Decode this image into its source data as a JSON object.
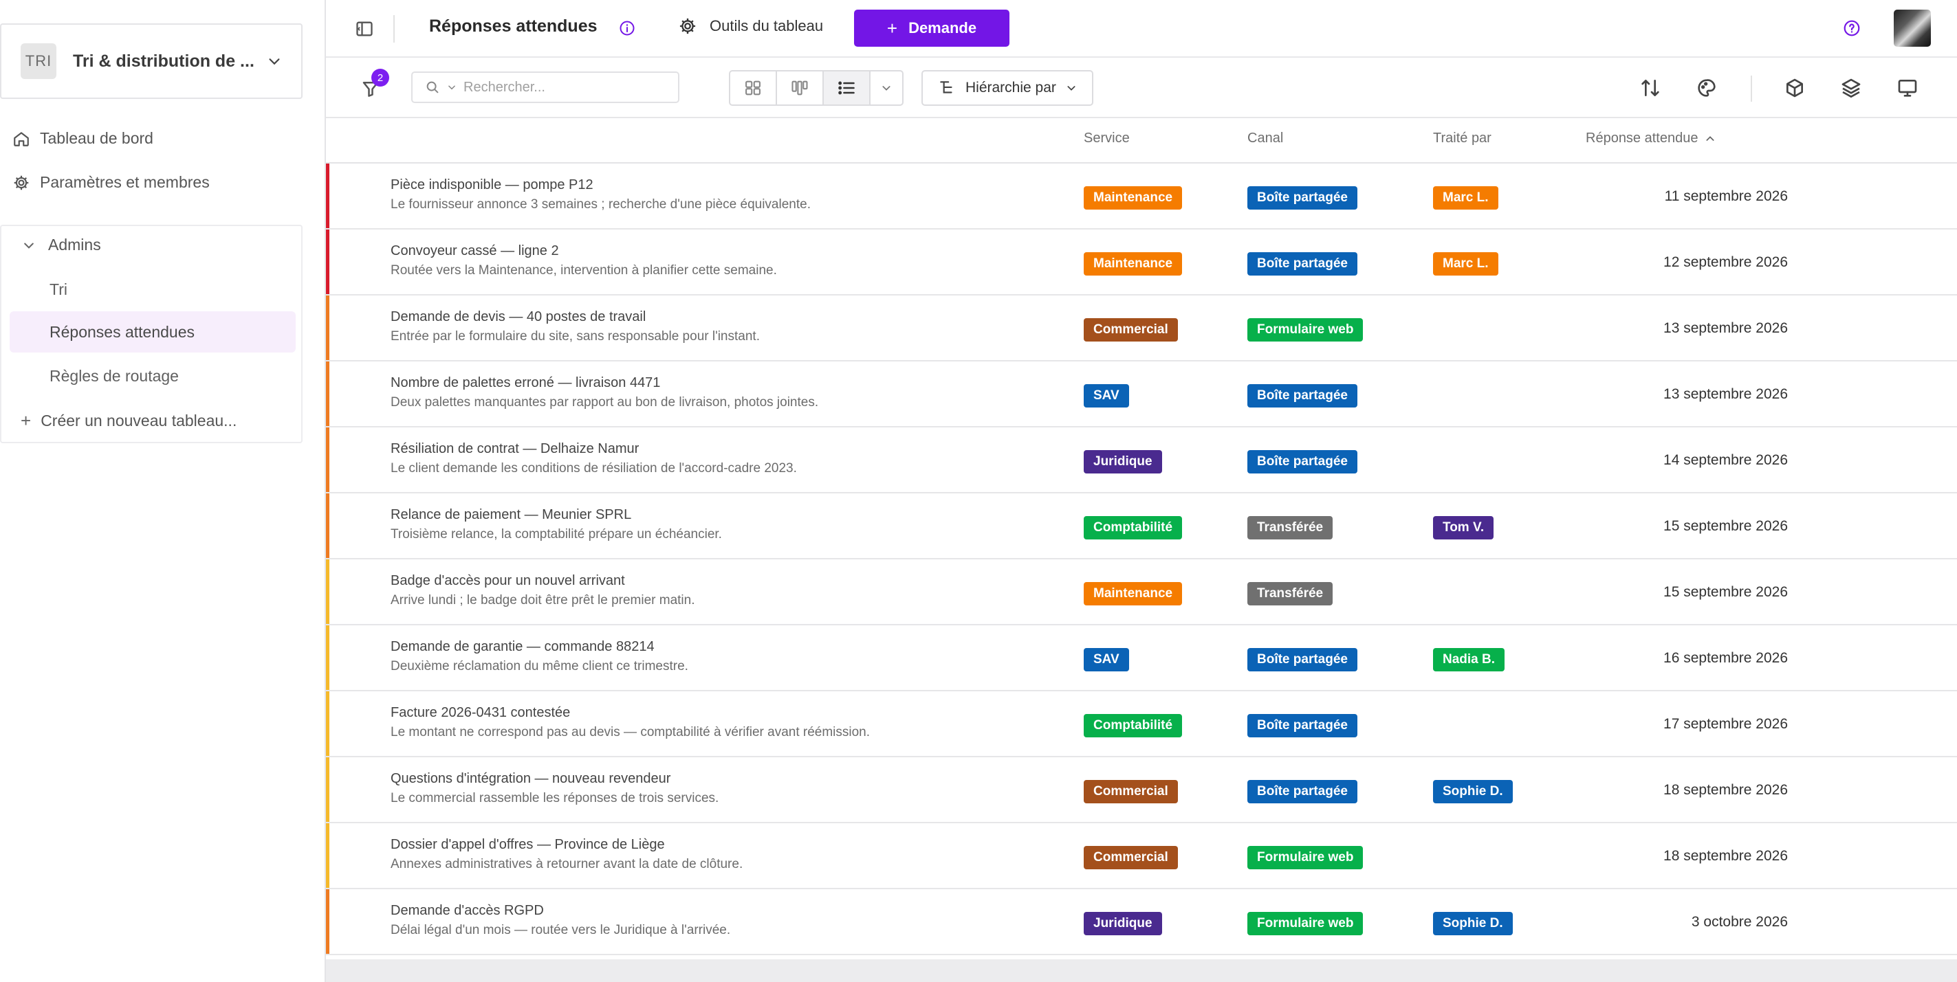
{
  "sidebar": {
    "workspace": {
      "initials": "TRI",
      "name": "Tri & distribution de ..."
    },
    "nav": [
      {
        "label": "Tableau de bord",
        "icon": "home-icon"
      },
      {
        "label": "Paramètres et membres",
        "icon": "gear-icon"
      }
    ],
    "group": {
      "label": "Admins",
      "items": [
        {
          "label": "Tri",
          "active": false
        },
        {
          "label": "Réponses attendues",
          "active": true
        },
        {
          "label": "Règles de routage",
          "active": false
        }
      ],
      "create_label": "Créer un nouveau tableau..."
    }
  },
  "topbar": {
    "title": "Réponses attendues",
    "tools_label": "Outils du tableau",
    "new_label": "Demande",
    "accent": "#7316e6"
  },
  "toolbar": {
    "filter_count": "2",
    "search_placeholder": "Rechercher...",
    "hierarchy_label": "Hiérarchie par"
  },
  "table": {
    "columns": {
      "service": "Service",
      "canal": "Canal",
      "owner": "Traité par",
      "due": "Réponse attendue"
    },
    "rows": [
      {
        "title": "Pièce indisponible — pompe P12",
        "subtitle": "Le fournisseur annonce 3 semaines ; recherche d'une pièce équivalente.",
        "bar": "#d81b2c",
        "service": "Maintenance",
        "service_color": "#f57c00",
        "canal": "Boîte partagée",
        "canal_color": "#0b63b6",
        "owner": "Marc L.",
        "owner_color": "#f57c00",
        "date": "11 septembre 2026"
      },
      {
        "title": "Convoyeur cassé — ligne 2",
        "subtitle": "Routée vers la Maintenance, intervention à planifier cette semaine.",
        "bar": "#d81b2c",
        "service": "Maintenance",
        "service_color": "#f57c00",
        "canal": "Boîte partagée",
        "canal_color": "#0b63b6",
        "owner": "Marc L.",
        "owner_color": "#f57c00",
        "date": "12 septembre 2026"
      },
      {
        "title": "Demande de devis — 40 postes de travail",
        "subtitle": "Entrée par le formulaire du site, sans responsable pour l'instant.",
        "bar": "#ee7b22",
        "service": "Commercial",
        "service_color": "#a4501c",
        "canal": "Formulaire web",
        "canal_color": "#07b04b",
        "owner": "",
        "owner_color": "",
        "date": "13 septembre 2026"
      },
      {
        "title": "Nombre de palettes erroné — livraison 4471",
        "subtitle": "Deux palettes manquantes par rapport au bon de livraison, photos jointes.",
        "bar": "#ee7b22",
        "service": "SAV",
        "service_color": "#0b63b6",
        "canal": "Boîte partagée",
        "canal_color": "#0b63b6",
        "owner": "",
        "owner_color": "",
        "date": "13 septembre 2026"
      },
      {
        "title": "Résiliation de contrat — Delhaize Namur",
        "subtitle": "Le client demande les conditions de résiliation de l'accord-cadre 2023.",
        "bar": "#ee7b22",
        "service": "Juridique",
        "service_color": "#4a2a8f",
        "canal": "Boîte partagée",
        "canal_color": "#0b63b6",
        "owner": "",
        "owner_color": "",
        "date": "14 septembre 2026"
      },
      {
        "title": "Relance de paiement — Meunier SPRL",
        "subtitle": "Troisième relance, la comptabilité prépare un échéancier.",
        "bar": "#ee7b22",
        "service": "Comptabilité",
        "service_color": "#07b04b",
        "canal": "Transférée",
        "canal_color": "#707070",
        "owner": "Tom V.",
        "owner_color": "#4a2a8f",
        "date": "15 septembre 2026"
      },
      {
        "title": "Badge d'accès pour un nouvel arrivant",
        "subtitle": "Arrive lundi ; le badge doit être prêt le premier matin.",
        "bar": "#f5b92b",
        "service": "Maintenance",
        "service_color": "#f57c00",
        "canal": "Transférée",
        "canal_color": "#707070",
        "owner": "",
        "owner_color": "",
        "date": "15 septembre 2026"
      },
      {
        "title": "Demande de garantie — commande 88214",
        "subtitle": "Deuxième réclamation du même client ce trimestre.",
        "bar": "#f5b92b",
        "service": "SAV",
        "service_color": "#0b63b6",
        "canal": "Boîte partagée",
        "canal_color": "#0b63b6",
        "owner": "Nadia B.",
        "owner_color": "#07b04b",
        "date": "16 septembre 2026"
      },
      {
        "title": "Facture 2026-0431 contestée",
        "subtitle": "Le montant ne correspond pas au devis — comptabilité à vérifier avant réémission.",
        "bar": "#f5b92b",
        "service": "Comptabilité",
        "service_color": "#07b04b",
        "canal": "Boîte partagée",
        "canal_color": "#0b63b6",
        "owner": "",
        "owner_color": "",
        "date": "17 septembre 2026"
      },
      {
        "title": "Questions d'intégration — nouveau revendeur",
        "subtitle": "Le commercial rassemble les réponses de trois services.",
        "bar": "#f5b92b",
        "service": "Commercial",
        "service_color": "#a4501c",
        "canal": "Boîte partagée",
        "canal_color": "#0b63b6",
        "owner": "Sophie D.",
        "owner_color": "#0b63b6",
        "date": "18 septembre 2026"
      },
      {
        "title": "Dossier d'appel d'offres — Province de Liège",
        "subtitle": "Annexes administratives à retourner avant la date de clôture.",
        "bar": "#f5b92b",
        "service": "Commercial",
        "service_color": "#a4501c",
        "canal": "Formulaire web",
        "canal_color": "#07b04b",
        "owner": "",
        "owner_color": "",
        "date": "18 septembre 2026"
      },
      {
        "title": "Demande d'accès RGPD",
        "subtitle": "Délai légal d'un mois — routée vers le Juridique à l'arrivée.",
        "bar": "#ee7b22",
        "service": "Juridique",
        "service_color": "#4a2a8f",
        "canal": "Formulaire web",
        "canal_color": "#07b04b",
        "owner": "Sophie D.",
        "owner_color": "#0b63b6",
        "date": "3 octobre 2026"
      }
    ]
  }
}
